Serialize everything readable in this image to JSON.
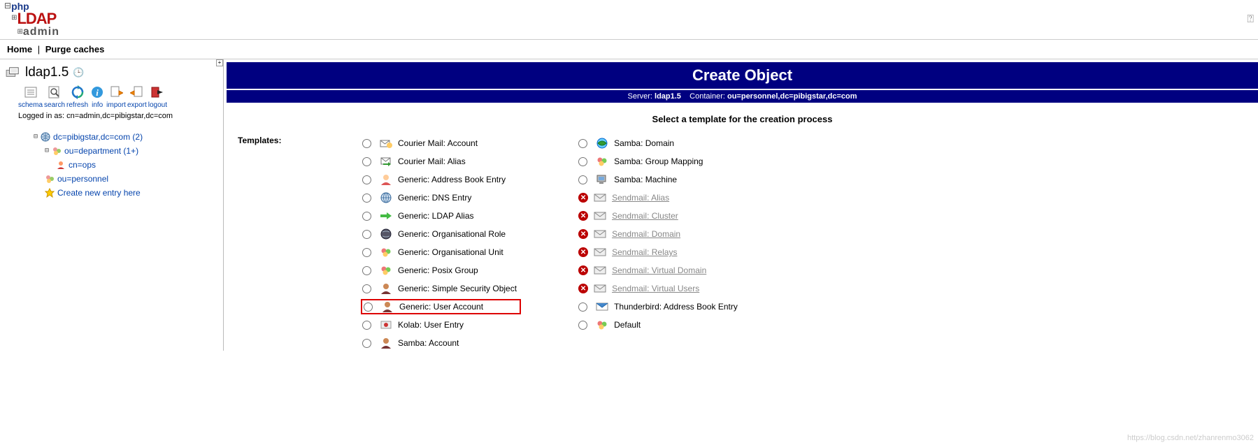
{
  "logo": {
    "line1": "php",
    "line2": "LDAP",
    "line3": "admin"
  },
  "topnav": {
    "home": "Home",
    "purge": "Purge caches"
  },
  "server": {
    "name": "ldap1.5",
    "logged_in_prefix": "Logged in as:",
    "logged_in_dn": "cn=admin,dc=pibigstar,dc=com"
  },
  "toolbar": [
    {
      "id": "schema",
      "label": "schema"
    },
    {
      "id": "search",
      "label": "search"
    },
    {
      "id": "refresh",
      "label": "refresh"
    },
    {
      "id": "info",
      "label": "info"
    },
    {
      "id": "import",
      "label": "import"
    },
    {
      "id": "export",
      "label": "export"
    },
    {
      "id": "logout",
      "label": "logout"
    }
  ],
  "tree": {
    "root": "dc=pibigstar,dc=com (2)",
    "dept": "ou=department (1+)",
    "ops": "cn=ops",
    "personnel": "ou=personnel",
    "create": "Create new entry here"
  },
  "main": {
    "title": "Create Object",
    "server_label": "Server:",
    "server_value": "ldap1.5",
    "container_label": "Container:",
    "container_value": "ou=personnel,dc=pibigstar,dc=com",
    "select_title": "Select a template for the creation process",
    "templates_label": "Templates:"
  },
  "templates_col1": [
    {
      "label": "Courier Mail: Account",
      "icon": "mail-acct",
      "disabled": false
    },
    {
      "label": "Courier Mail: Alias",
      "icon": "mail-alias",
      "disabled": false
    },
    {
      "label": "Generic: Address Book Entry",
      "icon": "user",
      "disabled": false
    },
    {
      "label": "Generic: DNS Entry",
      "icon": "globe",
      "disabled": false
    },
    {
      "label": "Generic: LDAP Alias",
      "icon": "arrow",
      "disabled": false
    },
    {
      "label": "Generic: Organisational Role",
      "icon": "globe-dark",
      "disabled": false
    },
    {
      "label": "Generic: Organisational Unit",
      "icon": "group",
      "disabled": false
    },
    {
      "label": "Generic: Posix Group",
      "icon": "group",
      "disabled": false
    },
    {
      "label": "Generic: Simple Security Object",
      "icon": "user-dark",
      "disabled": false
    },
    {
      "label": "Generic: User Account",
      "icon": "user-dark",
      "disabled": false,
      "highlight": true
    },
    {
      "label": "Kolab: User Entry",
      "icon": "kolab",
      "disabled": false
    },
    {
      "label": "Samba: Account",
      "icon": "user-dark",
      "disabled": false
    }
  ],
  "templates_col2": [
    {
      "label": "Samba: Domain",
      "icon": "samba-dom",
      "disabled": false
    },
    {
      "label": "Samba: Group Mapping",
      "icon": "group",
      "disabled": false
    },
    {
      "label": "Samba: Machine",
      "icon": "machine",
      "disabled": false
    },
    {
      "label": "Sendmail: Alias",
      "icon": "envelope",
      "disabled": true
    },
    {
      "label": "Sendmail: Cluster",
      "icon": "envelope",
      "disabled": true
    },
    {
      "label": "Sendmail: Domain",
      "icon": "envelope",
      "disabled": true
    },
    {
      "label": "Sendmail: Relays",
      "icon": "envelope",
      "disabled": true
    },
    {
      "label": "Sendmail: Virtual Domain",
      "icon": "envelope",
      "disabled": true
    },
    {
      "label": "Sendmail: Virtual Users",
      "icon": "envelope",
      "disabled": true
    },
    {
      "label": "Thunderbird: Address Book Entry",
      "icon": "tbird",
      "disabled": false
    },
    {
      "label": "Default",
      "icon": "group",
      "disabled": false
    }
  ],
  "watermark": "https://blog.csdn.net/zhanrenmo3062"
}
